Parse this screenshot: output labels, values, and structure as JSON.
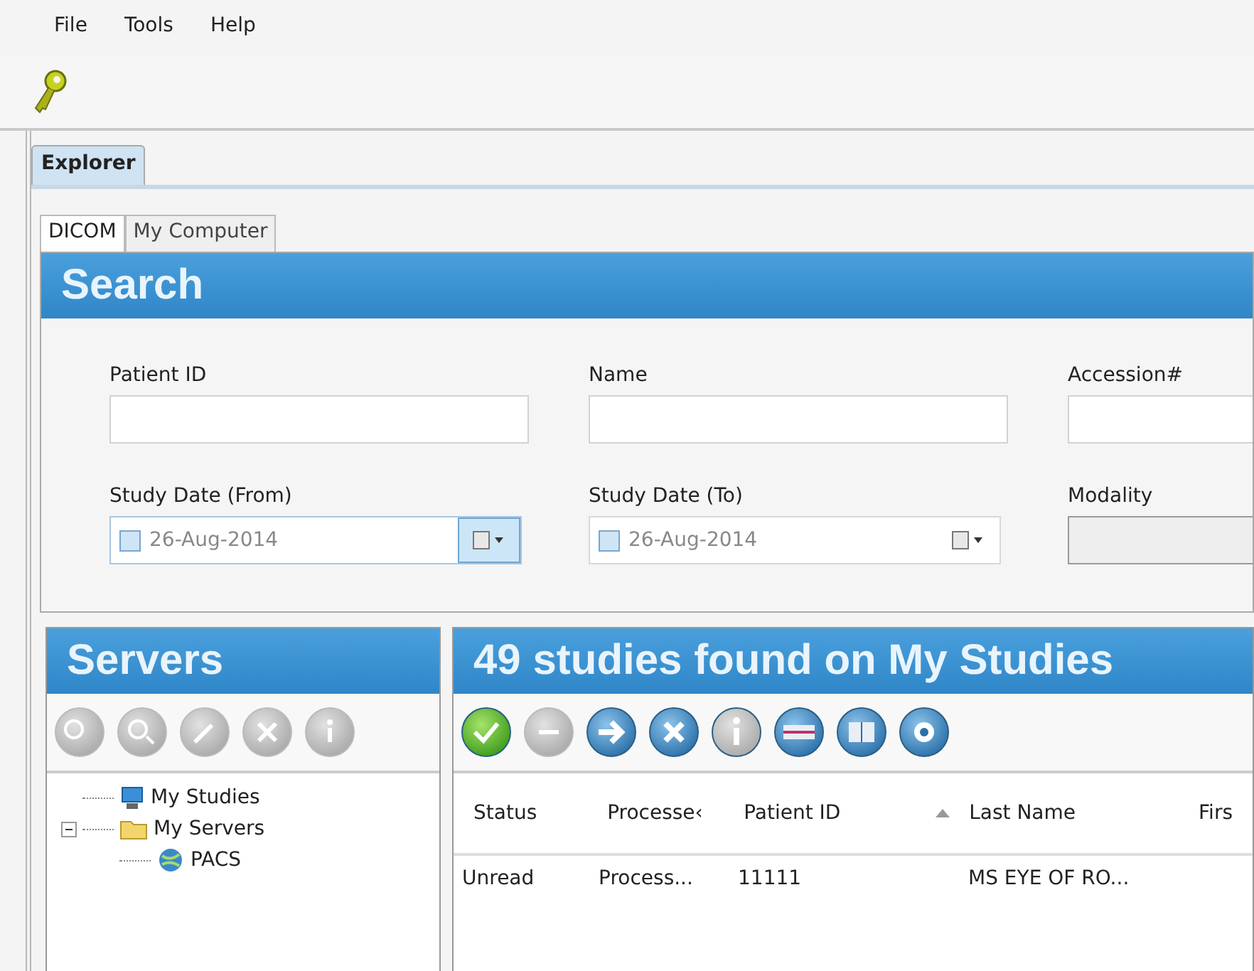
{
  "menu": [
    {
      "label": "File"
    },
    {
      "label": "Tools"
    },
    {
      "label": "Help"
    }
  ],
  "tabs": [
    {
      "label": "Explorer",
      "selected": true
    }
  ],
  "sub_tabs": [
    {
      "label": "DICOM",
      "selected": true
    },
    {
      "label": "My Computer",
      "selected": false
    }
  ],
  "search": {
    "title": "Search",
    "fields": [
      {
        "label": "Patient ID",
        "kind": "text"
      },
      {
        "label": "Name",
        "kind": "text"
      },
      {
        "label": "Accession#",
        "kind": "text"
      },
      {
        "label": "Study Date (From)",
        "kind": "date",
        "value": "26-Aug-2014",
        "checked": false,
        "focused": true
      },
      {
        "label": "Study Date (To)",
        "kind": "date",
        "value": "26-Aug-2014",
        "checked": false,
        "focused": false
      },
      {
        "label": "Modality",
        "kind": "select"
      }
    ]
  },
  "servers": {
    "title": "Servers",
    "tree": [
      {
        "label": "My Studies",
        "kind": "studies"
      },
      {
        "label": "My Servers",
        "kind": "folder",
        "expanded": true,
        "children": [
          {
            "label": "PACS",
            "kind": "server"
          }
        ]
      }
    ]
  },
  "results": {
    "title": "49 studies found on My Studies",
    "columns": [
      {
        "label": "Status",
        "sorted": false
      },
      {
        "label": "Processe‹",
        "sorted": false
      },
      {
        "label": "Patient ID",
        "sorted": true
      },
      {
        "label": "Last Name",
        "sorted": false
      },
      {
        "label": "Firs",
        "sorted": false
      }
    ],
    "rows": [
      {
        "cells": [
          "Unread",
          "Process...",
          "11111",
          "MS EYE OF RO..."
        ]
      }
    ]
  }
}
